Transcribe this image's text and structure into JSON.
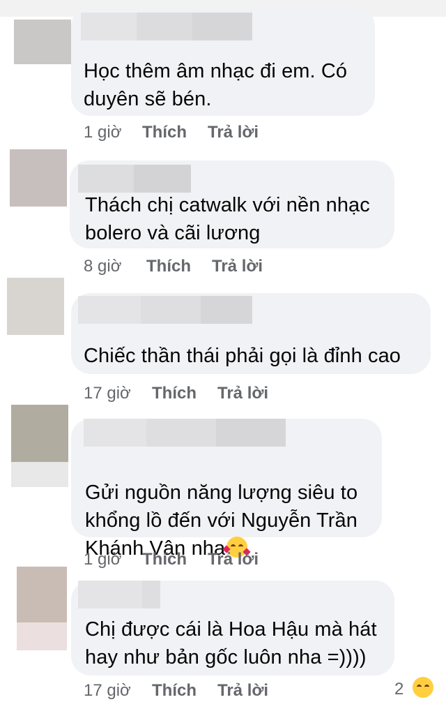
{
  "comments": [
    {
      "text": "Học thêm âm nhạc đi em. Có\nduyên sẽ bén.",
      "time": "1 giờ",
      "like": "Thích",
      "reply": "Trả lời"
    },
    {
      "text": "Thách chị catwalk với nền nhạc\nbolero và cãi lương",
      "time": "8 giờ",
      "like": "Thích",
      "reply": "Trả lời"
    },
    {
      "text": "Chiếc thần thái phải gọi là đỉnh cao",
      "time": "17 giờ",
      "like": "Thích",
      "reply": "Trả lời"
    },
    {
      "text": "Gửi nguồn năng lượng siêu to\nkhổng lồ đến với Nguyễn Trần\nKhánh Vân nha",
      "emoji": "smiling-face-with-hearts",
      "time": "1 giờ",
      "like": "Thích",
      "reply": "Trả lời"
    },
    {
      "text": "Chị được cái là Hoa Hậu mà hát\nhay như bản gốc luôn nha =))))",
      "time": "17 giờ",
      "like": "Thích",
      "reply": "Trả lời",
      "reaction_count": "2"
    }
  ],
  "colors": {
    "bubble": "#f0f2f5",
    "meta_text": "#65676b",
    "body_text": "#050505",
    "blur_name": "#d7d7da"
  }
}
